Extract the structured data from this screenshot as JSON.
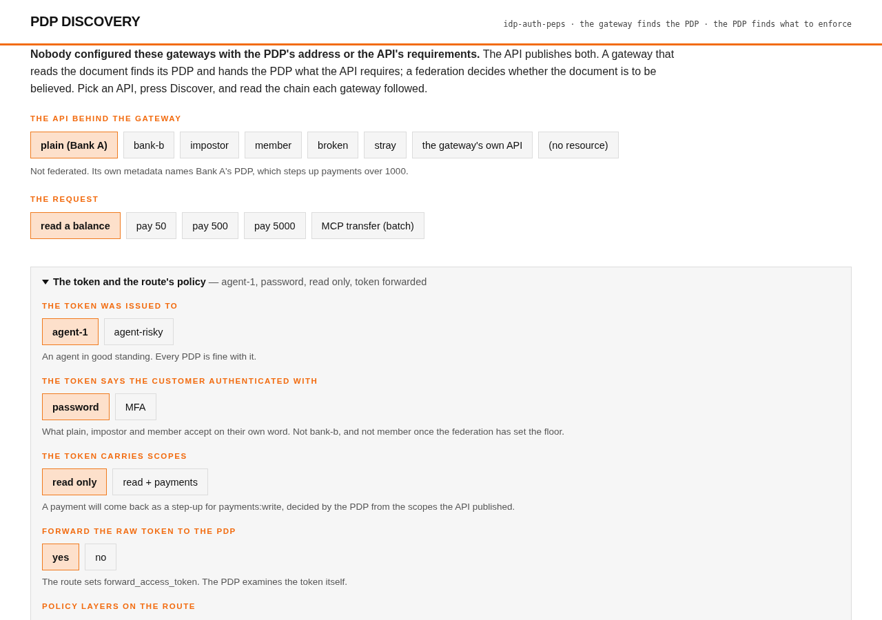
{
  "header": {
    "title": "PDP DISCOVERY",
    "tagline": "idp-auth-peps · the gateway finds the PDP · the PDP finds what to enforce"
  },
  "intro": "**Nobody configured these gateways with the PDP's address or the API's requirements.** The API publishes both. A gateway that reads the document finds its PDP and hands the PDP what the API requires; a federation decides whether the document is to be believed. Pick an API, press Discover, and read the chain each gateway followed.",
  "groups": [
    {
      "label": "THE API BEHIND THE GATEWAY",
      "options": [
        {
          "label": "plain (Bank A)",
          "selected": true
        },
        {
          "label": "bank-b",
          "selected": false
        },
        {
          "label": "impostor",
          "selected": false
        },
        {
          "label": "member",
          "selected": false
        },
        {
          "label": "broken",
          "selected": false
        },
        {
          "label": "stray",
          "selected": false
        },
        {
          "label": "the gateway's own API",
          "selected": false
        },
        {
          "label": "(no resource)",
          "selected": false
        }
      ],
      "note": "Not federated. Its own metadata names Bank A's PDP, which steps up payments over 1000."
    },
    {
      "label": "THE REQUEST",
      "options": [
        {
          "label": "read a balance",
          "selected": true
        },
        {
          "label": "pay 50",
          "selected": false
        },
        {
          "label": "pay 500",
          "selected": false
        },
        {
          "label": "pay 5000",
          "selected": false
        },
        {
          "label": "MCP transfer (batch)",
          "selected": false
        }
      ]
    }
  ],
  "panel": {
    "expanded": true,
    "title": "The token and the route's policy",
    "summary": "— agent-1, password, read only, token forwarded",
    "groups": [
      {
        "label": "THE TOKEN WAS ISSUED TO",
        "options": [
          {
            "label": "agent-1",
            "selected": true
          },
          {
            "label": "agent-risky",
            "selected": false
          }
        ],
        "note": "An agent in good standing. Every PDP is fine with it."
      },
      {
        "label": "THE TOKEN SAYS THE CUSTOMER AUTHENTICATED WITH",
        "options": [
          {
            "label": "password",
            "selected": true
          },
          {
            "label": "MFA",
            "selected": false
          }
        ],
        "note": "What plain, impostor and member accept on their own word. Not bank-b, and not member once the federation has set the floor."
      },
      {
        "label": "THE TOKEN CARRIES SCOPES",
        "options": [
          {
            "label": "read only",
            "selected": true
          },
          {
            "label": "read + payments",
            "selected": false
          }
        ],
        "note": "A payment will come back as a step-up for payments:write, decided by the PDP from the scopes the API published."
      },
      {
        "label": "FORWARD THE RAW TOKEN TO THE PDP",
        "options": [
          {
            "label": "yes",
            "selected": true
          },
          {
            "label": "no",
            "selected": false
          }
        ],
        "note": "The route sets forward_access_token. The PDP examines the token itself."
      },
      {
        "label": "POLICY LAYERS ON THE ROUTE"
      }
    ]
  }
}
